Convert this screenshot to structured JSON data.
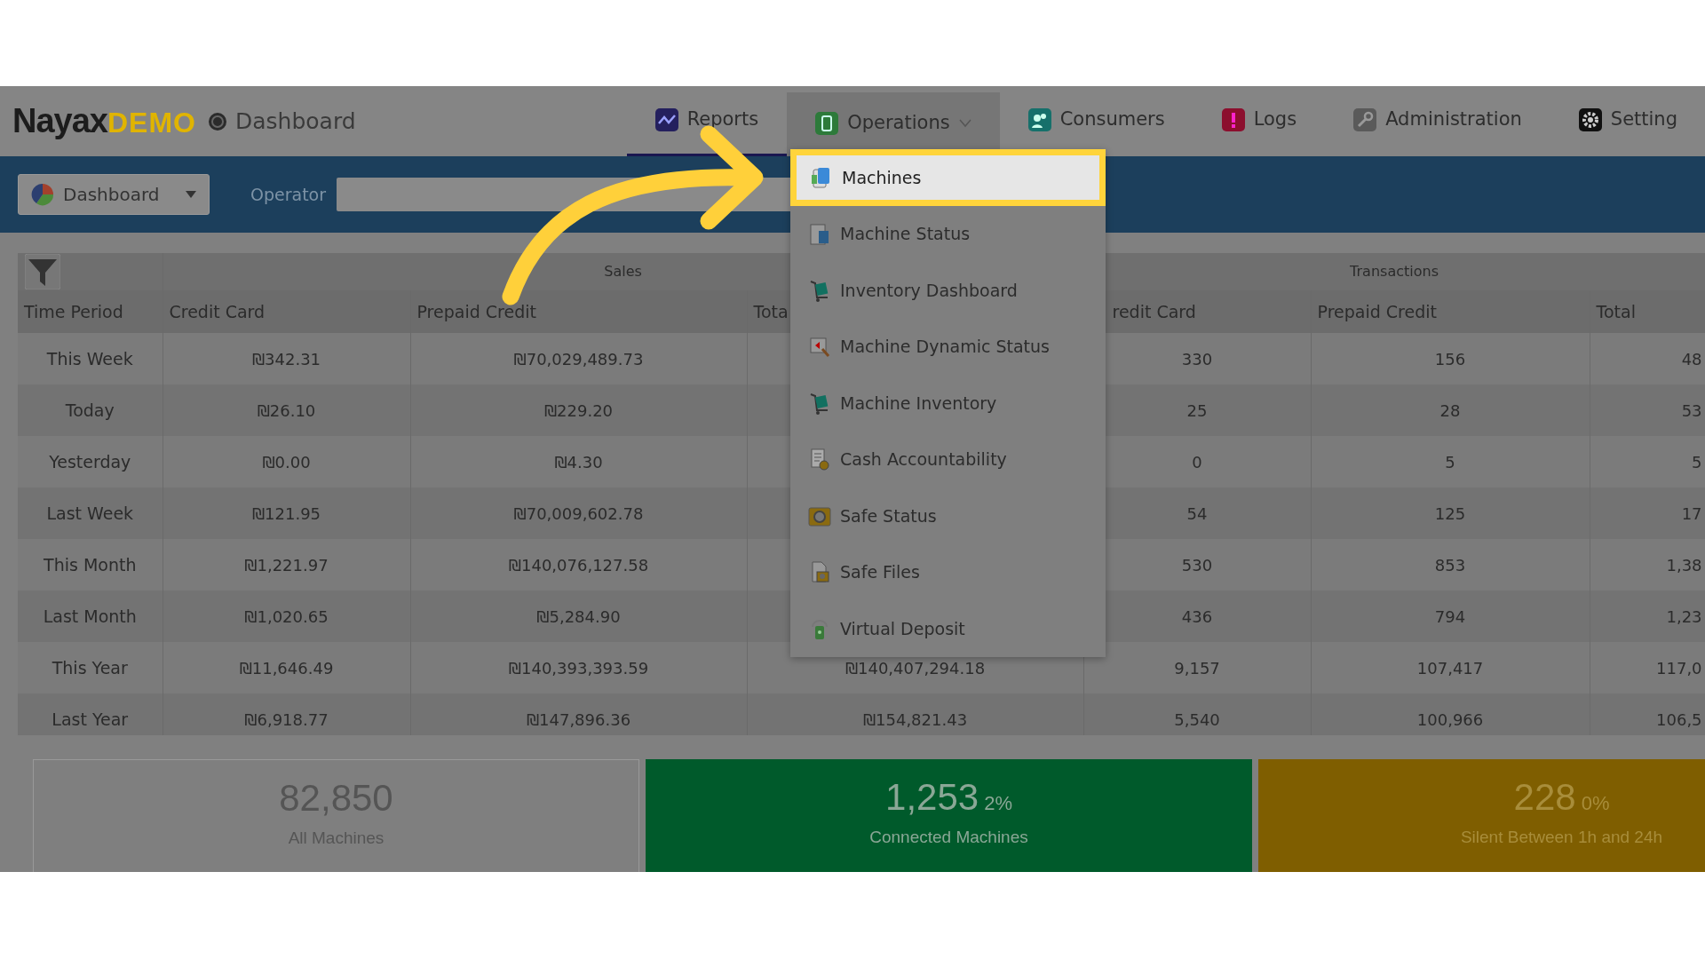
{
  "header": {
    "logo": {
      "brand": "Nayax",
      "tag": "DEMO"
    },
    "page_title": "Dashboard",
    "tabs": [
      {
        "label": "Reports",
        "selected": true,
        "expanded": false
      },
      {
        "label": "Operations",
        "selected": false,
        "expanded": true
      },
      {
        "label": "Consumers",
        "selected": false,
        "expanded": false
      },
      {
        "label": "Logs",
        "selected": false,
        "expanded": false
      },
      {
        "label": "Administration",
        "selected": false,
        "expanded": false
      },
      {
        "label": "Setting",
        "selected": false,
        "expanded": false
      }
    ]
  },
  "toolbar": {
    "view_button": "Dashboard",
    "operator_label": "Operator"
  },
  "table": {
    "groups": [
      "Sales",
      "Transactions"
    ],
    "columns": [
      "Time Period",
      "Credit Card",
      "Prepaid Credit",
      "Tota",
      "redit Card",
      "Prepaid Credit",
      "Total"
    ],
    "rows": [
      {
        "period": "This Week",
        "sales_credit": "₪342.31",
        "sales_prepaid": "₪70,029,489.73",
        "tx_credit": "330",
        "tx_prepaid": "156",
        "tx_total": "48"
      },
      {
        "period": "Today",
        "sales_credit": "₪26.10",
        "sales_prepaid": "₪229.20",
        "tx_credit": "25",
        "tx_prepaid": "28",
        "tx_total": "53"
      },
      {
        "period": "Yesterday",
        "sales_credit": "₪0.00",
        "sales_prepaid": "₪4.30",
        "tx_credit": "0",
        "tx_prepaid": "5",
        "tx_total": "5"
      },
      {
        "period": "Last Week",
        "sales_credit": "₪121.95",
        "sales_prepaid": "₪70,009,602.78",
        "tx_credit": "54",
        "tx_prepaid": "125",
        "tx_total": "17"
      },
      {
        "period": "This Month",
        "sales_credit": "₪1,221.97",
        "sales_prepaid": "₪140,076,127.58",
        "tx_credit": "530",
        "tx_prepaid": "853",
        "tx_total": "1,38"
      },
      {
        "period": "Last Month",
        "sales_credit": "₪1,020.65",
        "sales_prepaid": "₪5,284.90",
        "tx_credit": "436",
        "tx_prepaid": "794",
        "tx_total": "1,23"
      },
      {
        "period": "This Year",
        "sales_credit": "₪11,646.49",
        "sales_prepaid": "₪140,393,393.59",
        "sales_total": "₪140,407,294.18",
        "tx_credit": "9,157",
        "tx_prepaid": "107,417",
        "tx_total": "117,0"
      },
      {
        "period": "Last Year",
        "sales_credit": "₪6,918.77",
        "sales_prepaid": "₪147,896.36",
        "sales_total": "₪154,821.43",
        "tx_credit": "5,540",
        "tx_prepaid": "100,966",
        "tx_total": "106,5"
      }
    ]
  },
  "menu": {
    "items": [
      {
        "label": "Machines",
        "selected": true
      },
      {
        "label": "Machine Status",
        "selected": false
      },
      {
        "label": "Inventory Dashboard",
        "selected": false
      },
      {
        "label": "Machine Dynamic Status",
        "selected": false
      },
      {
        "label": "Machine Inventory",
        "selected": false
      },
      {
        "label": "Cash Accountability",
        "selected": false
      },
      {
        "label": "Safe Status",
        "selected": false
      },
      {
        "label": "Safe Files",
        "selected": false
      },
      {
        "label": "Virtual Deposit",
        "selected": false
      }
    ]
  },
  "cards": [
    {
      "value": "82,850",
      "caption": "All Machines",
      "color": "#7f7f7f"
    },
    {
      "value": "1,253",
      "percent": "2%",
      "caption": "Connected Machines",
      "color": "#005a2b"
    },
    {
      "value": "228",
      "percent": "0%",
      "caption": "Silent Between 1h and 24h",
      "color": "#7f5e00"
    }
  ]
}
